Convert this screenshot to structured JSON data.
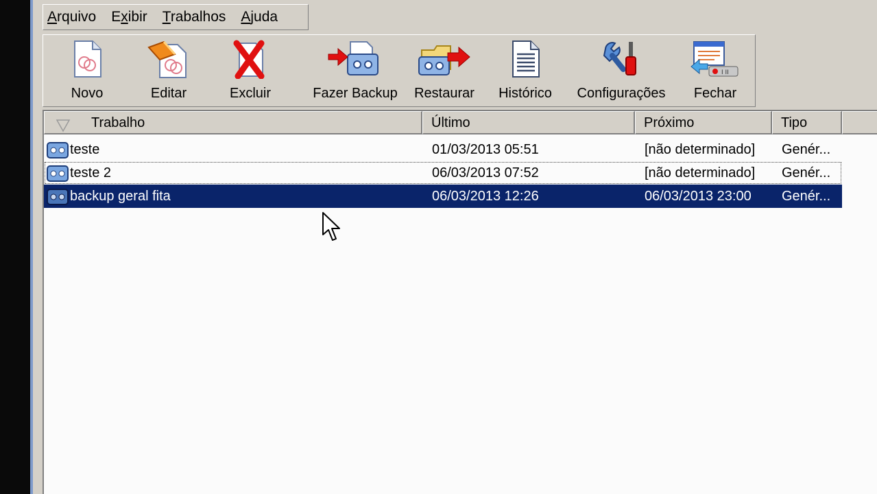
{
  "menu": {
    "items": [
      {
        "pre": "",
        "u": "A",
        "post": "rquivo"
      },
      {
        "pre": "E",
        "u": "x",
        "post": "ibir"
      },
      {
        "pre": "",
        "u": "T",
        "post": "rabalhos"
      },
      {
        "pre": "",
        "u": "A",
        "post": "juda"
      }
    ]
  },
  "toolbar": {
    "novo": "Novo",
    "editar": "Editar",
    "excluir": "Excluir",
    "fazer_backup": "Fazer Backup",
    "restaurar": "Restaurar",
    "historico": "Histórico",
    "configuracoes": "Configurações",
    "fechar": "Fechar"
  },
  "list": {
    "columns": {
      "trabalho": "Trabalho",
      "ultimo": "Último",
      "proximo": "Próximo",
      "tipo": "Tipo"
    },
    "rows": [
      {
        "name": "teste",
        "ultimo": "01/03/2013 05:51",
        "proximo": "[não determinado]",
        "tipo": "Genér..."
      },
      {
        "name": "teste 2",
        "ultimo": "06/03/2013 07:52",
        "proximo": "[não determinado]",
        "tipo": "Genér..."
      },
      {
        "name": "backup geral fita",
        "ultimo": "06/03/2013 12:26",
        "proximo": "06/03/2013 23:00",
        "tipo": "Genér..."
      }
    ]
  },
  "colors": {
    "selection": "#0a246a",
    "window_bg": "#d4d0c8",
    "list_bg": "#fbfbfb"
  }
}
